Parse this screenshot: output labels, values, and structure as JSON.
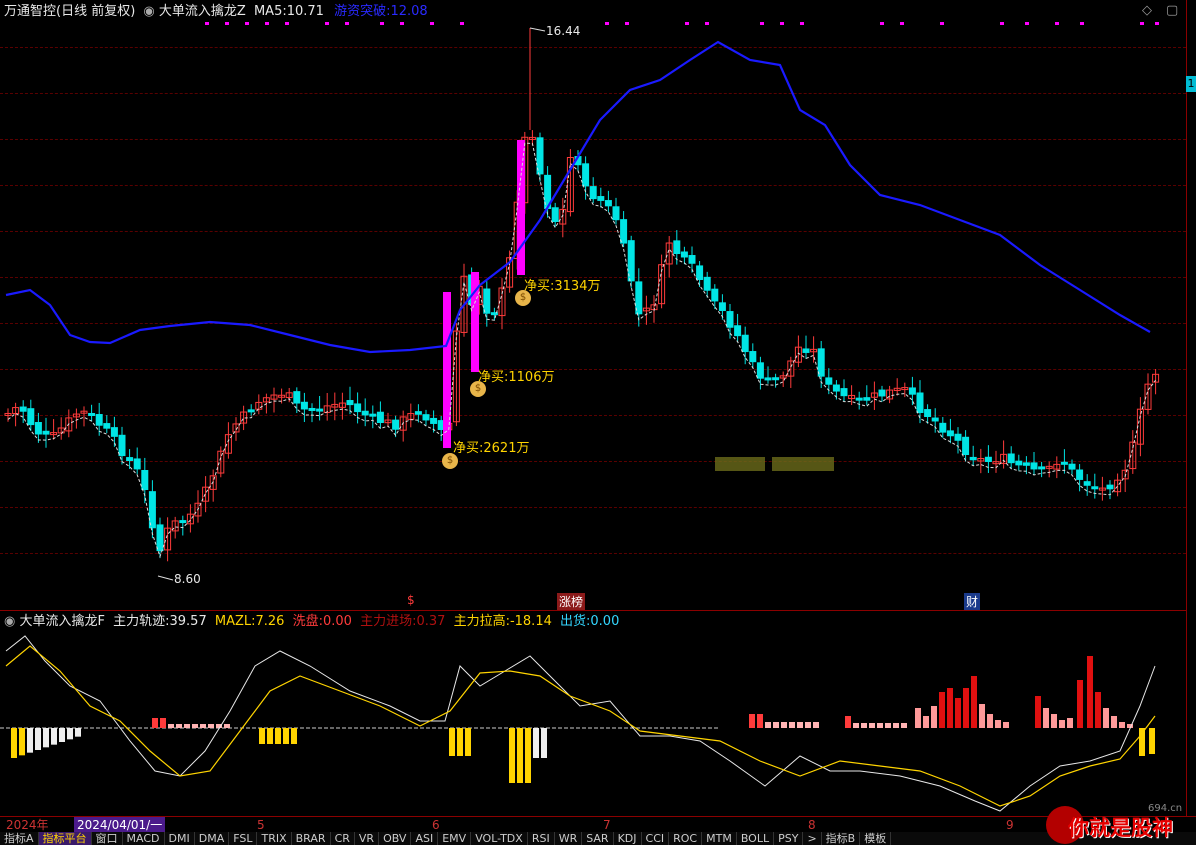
{
  "header": {
    "stock_name": "万通智控(日线 前复权)",
    "indicator_name": "大单流入擒龙Z",
    "ma5_label": "MA5:",
    "ma5_value": "10.71",
    "breakout_label": "游资突破:",
    "breakout_value": "12.08"
  },
  "sub_header": {
    "name": "大单流入擒龙F",
    "track_label": "主力轨迹:",
    "track_value": "39.57",
    "mazl_label": "MAZL:",
    "mazl_value": "7.26",
    "wash_label": "洗盘:",
    "wash_value": "0.00",
    "enter_label": "主力进场:",
    "enter_value": "0.37",
    "lift_label": "主力拉高:",
    "lift_value": "-18.14",
    "ship_label": "出货:",
    "ship_value": "0.00"
  },
  "annotations": {
    "high_label": "16.44",
    "low_label": "8.60",
    "buy1": "净买:2621万",
    "buy2": "净买:1106万",
    "buy3": "净买:3134万",
    "marker_s": "$",
    "marker_zhangbang": "涨榜",
    "marker_cai": "财"
  },
  "right_edge_label": "1",
  "datebar": {
    "year": "2024年",
    "cursor_date": "2024/04/01/一",
    "months": [
      "5",
      "6",
      "7",
      "8",
      "9"
    ]
  },
  "tabs": [
    "指标A",
    "指标平台",
    "窗口",
    "MACD",
    "DMI",
    "DMA",
    "FSL",
    "TRIX",
    "BRAR",
    "CR",
    "VR",
    "OBV",
    "ASI",
    "EMV",
    "VOL-TDX",
    "RSI",
    "WR",
    "SAR",
    "KDJ",
    "CCI",
    "ROC",
    "MTM",
    "BOLL",
    "PSY",
    ">",
    "指标B",
    "模板"
  ],
  "watermark": {
    "domain": "694.cn",
    "text": "你就是股神"
  },
  "colors": {
    "up": "#ff3b3b",
    "down": "#00e5e5",
    "blue_line": "#1a1aff",
    "magenta": "#ff00ff",
    "yellow": "#ffd400"
  },
  "chart_data": {
    "type": "candlestick",
    "price_high": 16.44,
    "price_low": 8.6,
    "ma5_last": 10.71,
    "breakout_last": 12.08,
    "net_buy_annotations": [
      "净买:2621万",
      "净买:1106万",
      "净买:3134万"
    ],
    "x_months": [
      "5",
      "6",
      "7",
      "8",
      "9"
    ],
    "subchart": {
      "name": "大单流入擒龙F",
      "series": [
        {
          "name": "主力轨迹",
          "last": 39.57
        },
        {
          "name": "MAZL",
          "last": 7.26
        },
        {
          "name": "洗盘",
          "last": 0.0
        },
        {
          "name": "主力进场",
          "last": 0.37
        },
        {
          "name": "主力拉高",
          "last": -18.14
        },
        {
          "name": "出货",
          "last": 0.0
        }
      ]
    }
  }
}
